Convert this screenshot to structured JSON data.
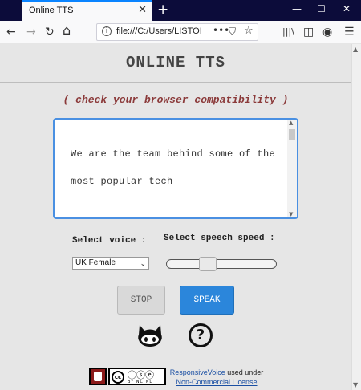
{
  "browser": {
    "tab_title": "Online TTS",
    "tab_close": "✕",
    "new_tab": "+",
    "minimize": "—",
    "maximize": "☐",
    "close": "✕",
    "url": "file:///C:/Users/LISTOI",
    "url_more": "•••",
    "back": "←",
    "forward": "→",
    "reload": "↻",
    "home": "⌂",
    "library": "|||\\",
    "sidebar": "◫",
    "account": "◉",
    "menu": "☰"
  },
  "page": {
    "title": "ONLINE TTS",
    "compat_link": "( check your browser compatibility )",
    "textarea_value": "We are the team behind some of the most popular tech",
    "select_voice_label": "Select voice :",
    "select_speed_label": "Select speech speed :",
    "voice_selected": "UK Female",
    "speed": 0.35,
    "stop_label": "STOP",
    "speak_label": "SPEAK",
    "help_label": "?"
  },
  "footer": {
    "link1": "ResponsiveVoice",
    "text_mid": " used under ",
    "link2": "Non-Commercial License",
    "cc_label": "cc",
    "cc_sub": "BY NC ND"
  },
  "colors": {
    "speak_button": "#2b86db",
    "textarea_border": "#4a90e2",
    "compat_link": "#8b3a3a",
    "tabbar": "#0c0c3a"
  }
}
